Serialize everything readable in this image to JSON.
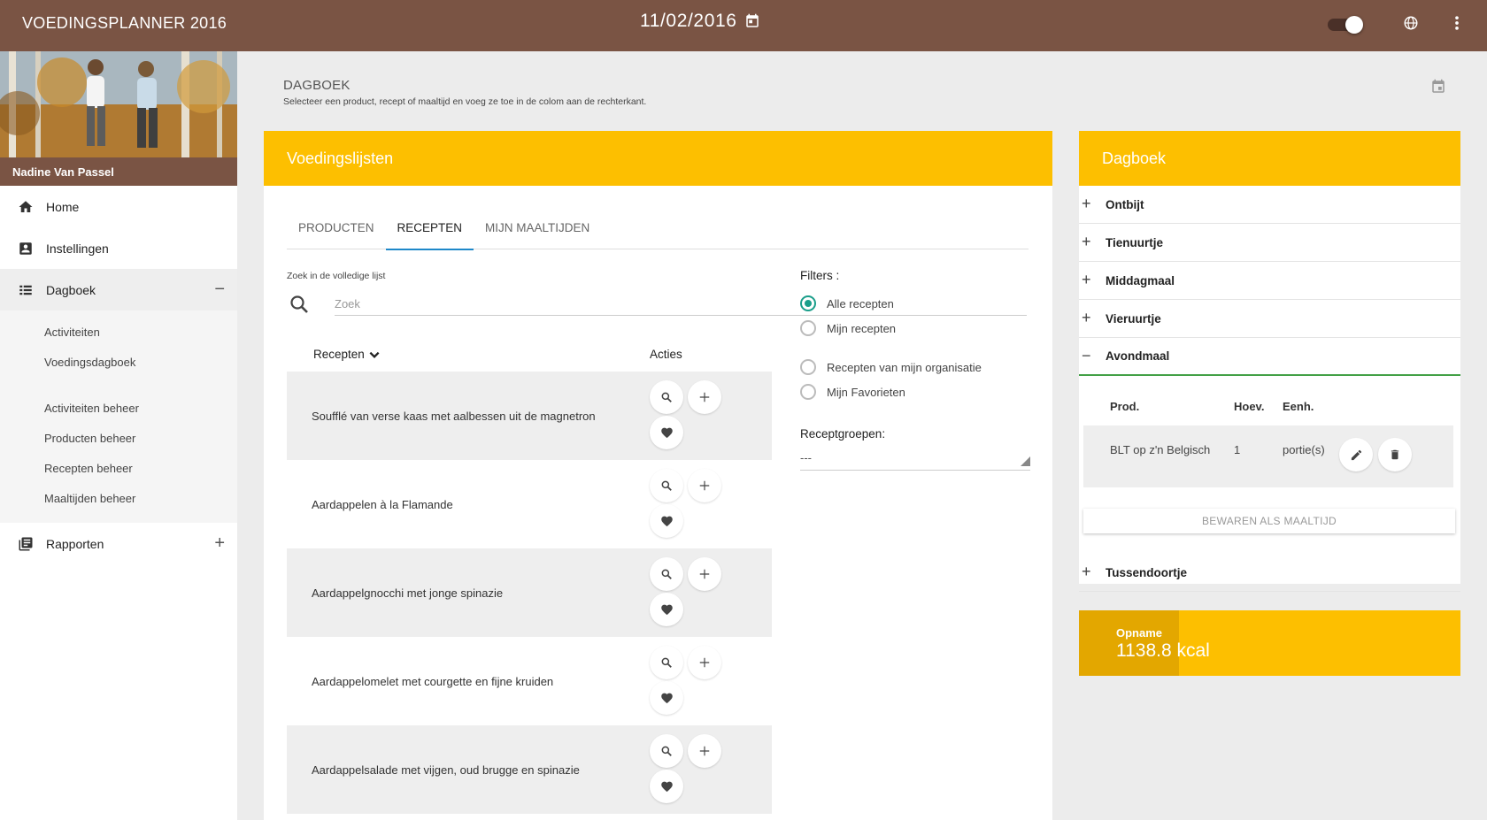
{
  "header": {
    "app_title": "VOEDINGSPLANNER 2016",
    "date": "11/02/2016",
    "icons": [
      "calendar-icon",
      "toggle-switch",
      "globe-icon",
      "more-vert-icon"
    ]
  },
  "sidebar": {
    "user_name": "Nadine Van Passel",
    "items": [
      {
        "label": "Home",
        "icon": "home-icon"
      },
      {
        "label": "Instellingen",
        "icon": "account-box-icon"
      },
      {
        "label": "Dagboek",
        "icon": "list-icon",
        "sign": "−"
      },
      {
        "label": "Rapporten",
        "icon": "library-books-icon",
        "sign": "+"
      }
    ],
    "sub_items": [
      "Activiteiten",
      "Voedingsdagboek",
      "Activiteiten beheer",
      "Producten beheer",
      "Recepten beheer",
      "Maaltijden beheer"
    ]
  },
  "page": {
    "title": "DAGBOEK",
    "subtitle": "Selecteer een product, recept of maaltijd en voeg ze toe in de colom aan de rechterkant."
  },
  "lists": {
    "title": "Voedingslijsten",
    "tabs": [
      "PRODUCTEN",
      "RECEPTEN",
      "MIJN MAALTIJDEN"
    ],
    "active_tab": "RECEPTEN",
    "search_label": "Zoek in de volledige lijst",
    "search_placeholder": "Zoek",
    "col_recipes": "Recepten",
    "col_actions": "Acties",
    "recipes": [
      "Soufflé van verse kaas met aalbessen uit de magnetron",
      "Aardappelen à la Flamande",
      "Aardappelgnocchi met jonge spinazie",
      "Aardappelomelet met courgette en fijne kruiden",
      "Aardappelsalade met vijgen, oud brugge en spinazie"
    ],
    "filters_title": "Filters :",
    "filters": [
      "Alle recepten",
      "Mijn recepten",
      "Recepten van mijn organisatie",
      "Mijn Favorieten"
    ],
    "selected_filter": "Alle recepten",
    "groups_label": "Receptgroepen:",
    "groups_value": "---"
  },
  "diary": {
    "title": "Dagboek",
    "meals": [
      "Ontbijt",
      "Tienuurtje",
      "Middagmaal",
      "Vieruurtje",
      "Avondmaal",
      "Tussendoortje"
    ],
    "open_meal": "Avondmaal",
    "table_headers": [
      "Prod.",
      "Hoev.",
      "Eenh."
    ],
    "entries": [
      {
        "product": "BLT op z'n Belgisch",
        "amount": "1",
        "unit": "portie(s)"
      }
    ],
    "save_label": "BEWAREN ALS MAALTIJD"
  },
  "intake": {
    "label": "Opname",
    "value": "1138.8 kcal"
  },
  "colors": {
    "topbar": "#7a5444",
    "accent": "#fdbf00",
    "radio": "#1a9e8a",
    "open_meal_line": "#43a047"
  }
}
